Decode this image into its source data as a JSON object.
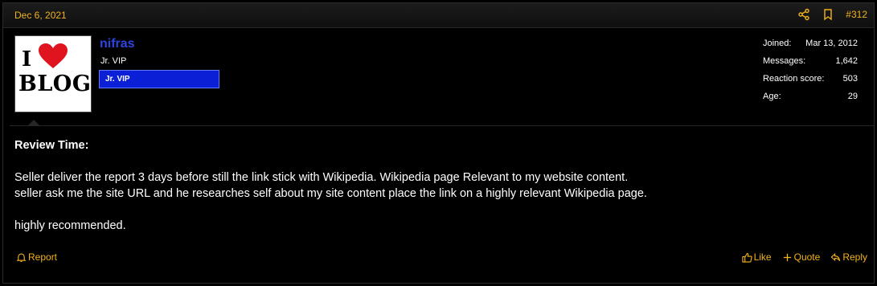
{
  "post": {
    "date": "Dec 6, 2021",
    "number": "#312",
    "share_icon": "share-icon",
    "bookmark_icon": "bookmark-icon"
  },
  "user": {
    "avatar": {
      "line1": "I",
      "line2": "BLOG",
      "icon": "heart-icon"
    },
    "name": "nifras",
    "title": "Jr. VIP",
    "banner": "Jr. VIP",
    "stats": [
      {
        "label": "Joined:",
        "value": "Mar 13, 2012"
      },
      {
        "label": "Messages:",
        "value": "1,642"
      },
      {
        "label": "Reaction score:",
        "value": "503"
      },
      {
        "label": "Age:",
        "value": "29"
      }
    ]
  },
  "message": {
    "heading": "Review Time:",
    "line1": "Seller deliver the report 3 days before still the link stick with Wikipedia. Wikipedia page Relevant to my website content.",
    "line2": "seller ask me the site URL and he researches self about my site content place the link on a highly relevant Wikipedia page.",
    "line3": "highly recommended."
  },
  "footer": {
    "report": "Report",
    "like": "Like",
    "quote": "Quote",
    "reply": "Reply"
  },
  "colors": {
    "accent": "#f2b31b",
    "username": "#2e45e0",
    "banner": "#0b1fd6",
    "background": "#000000"
  }
}
